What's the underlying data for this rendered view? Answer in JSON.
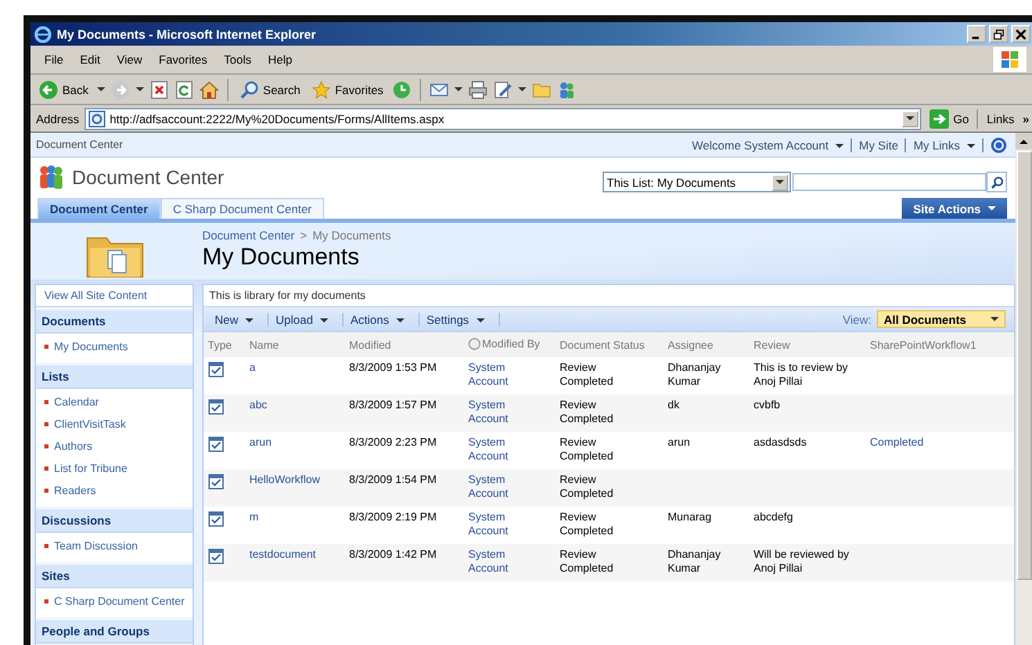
{
  "window": {
    "title": "My Documents - Microsoft Internet Explorer"
  },
  "menu": [
    "File",
    "Edit",
    "View",
    "Favorites",
    "Tools",
    "Help"
  ],
  "toolbar": {
    "back": "Back",
    "search": "Search",
    "favorites": "Favorites"
  },
  "address": {
    "label": "Address",
    "url": "http://adfsaccount:2222/My%20Documents/Forms/AllItems.aspx",
    "go": "Go",
    "links": "Links",
    "more": "»"
  },
  "site": {
    "crumb": "Document Center",
    "user_links": [
      {
        "label": "Welcome System Account",
        "dropdown": true
      },
      {
        "label": "My Site",
        "dropdown": false
      },
      {
        "label": "My Links",
        "dropdown": true
      }
    ],
    "title": "Document Center",
    "search_scope": "This List: My Documents",
    "tabs": [
      {
        "label": "Document Center",
        "selected": true
      },
      {
        "label": "C Sharp Document Center",
        "selected": false
      }
    ],
    "site_actions": "Site Actions"
  },
  "page": {
    "breadcrumb": [
      "Document Center",
      "My Documents"
    ],
    "breadcrumb_separator": ">",
    "title": "My Documents"
  },
  "nav": {
    "view_all": "View All Site Content",
    "sections": [
      {
        "heading": "Documents",
        "items": [
          "My Documents"
        ]
      },
      {
        "heading": "Lists",
        "items": [
          "Calendar",
          "ClientVisitTask",
          "Authors",
          "List for Tribune",
          "Readers"
        ]
      },
      {
        "heading": "Discussions",
        "items": [
          "Team Discussion"
        ]
      },
      {
        "heading": "Sites",
        "items": [
          "C Sharp Document Center"
        ]
      },
      {
        "heading": "People and Groups"
      }
    ]
  },
  "library": {
    "description": "This is library for my documents",
    "menus": [
      "New",
      "Upload",
      "Actions",
      "Settings"
    ],
    "view_label": "View:",
    "view": "All Documents",
    "columns": [
      {
        "label": "Type",
        "filter_icon": false
      },
      {
        "label": "Name",
        "filter_icon": false
      },
      {
        "label": "Modified",
        "filter_icon": false
      },
      {
        "label": "Modified By",
        "filter_icon": true
      },
      {
        "label": "Document Status",
        "filter_icon": false
      },
      {
        "label": "Assignee",
        "filter_icon": false
      },
      {
        "label": "Review",
        "filter_icon": false
      },
      {
        "label": "SharePointWorkflow1",
        "filter_icon": false
      }
    ],
    "rows": [
      {
        "name": "a",
        "modified": "8/3/2009 1:53 PM",
        "modified_by": "System Account",
        "status": "Review Completed",
        "assignee": "Dhananjay Kumar",
        "review": "This is to review by Anoj Pillai"
      },
      {
        "name": "abc",
        "modified": "8/3/2009 1:57 PM",
        "modified_by": "System Account",
        "status": "Review Completed",
        "assignee": "dk",
        "review": "cvbfb"
      },
      {
        "name": "arun",
        "modified": "8/3/2009 2:23 PM",
        "modified_by": "System Account",
        "status": "Review Completed",
        "assignee": "arun",
        "review": "asdasdsds",
        "workflow": "Completed"
      },
      {
        "name": "HelloWorkflow",
        "modified": "8/3/2009 1:54 PM",
        "modified_by": "System Account",
        "status": "Review Completed"
      },
      {
        "name": "m",
        "modified": "8/3/2009 2:19 PM",
        "modified_by": "System Account",
        "status": "Review Completed",
        "assignee": "Munarag",
        "review": "abcdefg"
      },
      {
        "name": "testdocument",
        "modified": "8/3/2009 1:42 PM",
        "modified_by": "System Account",
        "status": "Review Completed",
        "assignee": "Dhananjay Kumar",
        "review": "Will be reviewed by Anoj Pillai"
      }
    ]
  }
}
